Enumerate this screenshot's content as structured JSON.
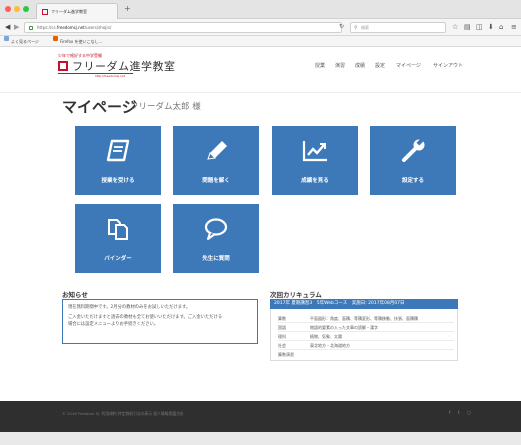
{
  "browser": {
    "tab_title": "フリーダム進学教室",
    "tab_close": "×",
    "new_tab": "+",
    "url_prefix": "https://cs.",
    "url_domain": "freedomsj.net",
    "url_path": "/users/shojin/",
    "search_placeholder": "検索",
    "traffic_colors": [
      "#ff5f57",
      "#febc2e",
      "#28c840"
    ],
    "bookmarks": [
      "よく見るページ",
      "Firefox を使いこなし..."
    ]
  },
  "site": {
    "logo_tagline": "少年で格好する中学受験",
    "logo_name": "フリーダム進学教室",
    "logo_url": "http://freedomsj.net",
    "brand_color": "#c8102e",
    "nav": [
      "授業",
      "演習",
      "成績",
      "設定",
      "マイページ",
      "サインアウト"
    ]
  },
  "page": {
    "title": "マイページ",
    "user": "フリーダム太郎 様"
  },
  "tiles": [
    {
      "label": "授業を受ける",
      "icon": "book-icon"
    },
    {
      "label": "問題を解く",
      "icon": "pencil-icon"
    },
    {
      "label": "成績を見る",
      "icon": "chart-icon"
    },
    {
      "label": "設定する",
      "icon": "wrench-icon"
    },
    {
      "label": "バインダー",
      "icon": "copy-icon"
    },
    {
      "label": "先生に質問",
      "icon": "chat-icon"
    }
  ],
  "tile_color": "#3d79b9",
  "notice": {
    "title": "お知らせ",
    "lines": [
      "現在無料期間中です。2月分の教材のみをお試しいただけます。",
      "ご入金いただけますと過去の教材も全てお使いいただけます。ご入金いただける",
      "場合には設定メニューよりお手続きください。"
    ]
  },
  "curriculum": {
    "title": "次回カリキュラム",
    "header": "2017年 夏期講習3　5年Webコース　実施日: 2017年08月07日",
    "rows": [
      {
        "subject": "算数",
        "desc": "平面図形：角度、面積、等積変形、等積移動、扶張、面積積"
      },
      {
        "subject": "国語",
        "desc": "物語的要素の入った文章の読解・漢字"
      },
      {
        "subject": "理科",
        "desc": "植物、気象、太陽"
      },
      {
        "subject": "社会",
        "desc": "東北地方・北海道地方"
      },
      {
        "subject": "算数演習",
        "desc": ""
      }
    ]
  },
  "footer": {
    "text": "© 2016 Freedom SJ.  利用規約  特定商取引法の表示  個人情報保護方針",
    "social": [
      "f",
      "t",
      "○"
    ]
  }
}
